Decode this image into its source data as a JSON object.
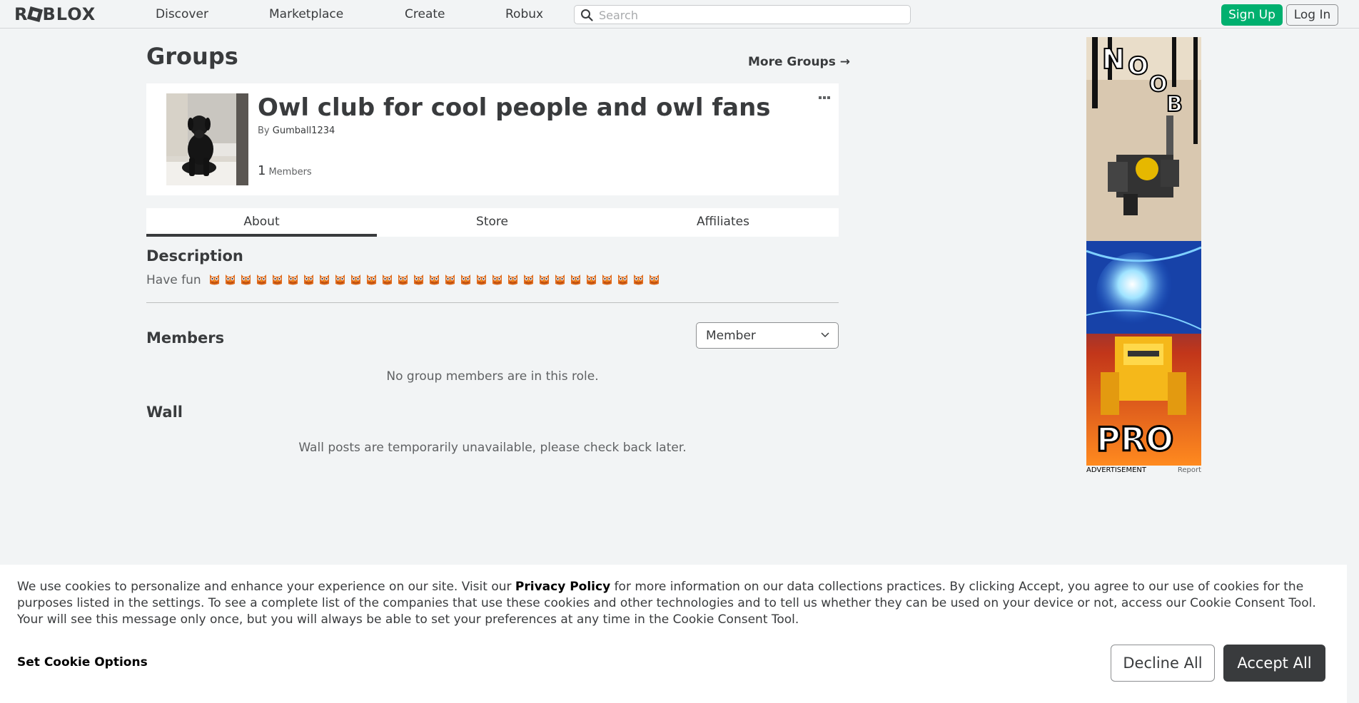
{
  "header": {
    "logo_text": "ROBLOX",
    "nav": [
      {
        "label": "Discover"
      },
      {
        "label": "Marketplace"
      },
      {
        "label": "Create"
      },
      {
        "label": "Robux"
      }
    ],
    "search_placeholder": "Search",
    "signup_label": "Sign Up",
    "login_label": "Log In"
  },
  "page": {
    "title": "Groups",
    "more_groups_label": "More Groups →"
  },
  "group": {
    "name": "Owl club for cool people and owl fans",
    "by_prefix": "By",
    "owner": "Gumball1234",
    "member_count": "1",
    "members_label": "Members"
  },
  "tabs": [
    {
      "label": "About",
      "active": true
    },
    {
      "label": "Store",
      "active": false
    },
    {
      "label": "Affiliates",
      "active": false
    }
  ],
  "about": {
    "description_heading": "Description",
    "description_text": "Have fun",
    "owl_emoji_count": 29,
    "members_heading": "Members",
    "role_selected": "Member",
    "members_empty": "No group members are in this role.",
    "wall_heading": "Wall",
    "wall_empty": "Wall posts are temporarily unavailable, please check back later."
  },
  "ad": {
    "top_text": "NOOB",
    "bottom_text": "PRO",
    "caption_left": "ADVERTISEMENT",
    "caption_right": "Report"
  },
  "cookie_banner": {
    "text_before_link": "We use cookies to personalize and enhance your experience on our site. Visit our ",
    "link_text": "Privacy Policy",
    "text_after_link": " for more information on our data collections practices. By clicking Accept, you agree to our use of cookies for the purposes listed in the settings. To see a complete list of the companies that use these cookies and other technologies and to tell us whether they can be used on your device or not, access our Cookie Consent Tool. Your will see this message only once, but you will always be able to set your preferences at any time in the Cookie Consent Tool.",
    "options_label": "Set Cookie Options",
    "decline_label": "Decline All",
    "accept_label": "Accept All"
  },
  "colors": {
    "accent_green": "#00b06f",
    "text_dark": "#393b3d",
    "page_bg": "#f2f4f5",
    "owl_orange": "#e06a1b"
  }
}
